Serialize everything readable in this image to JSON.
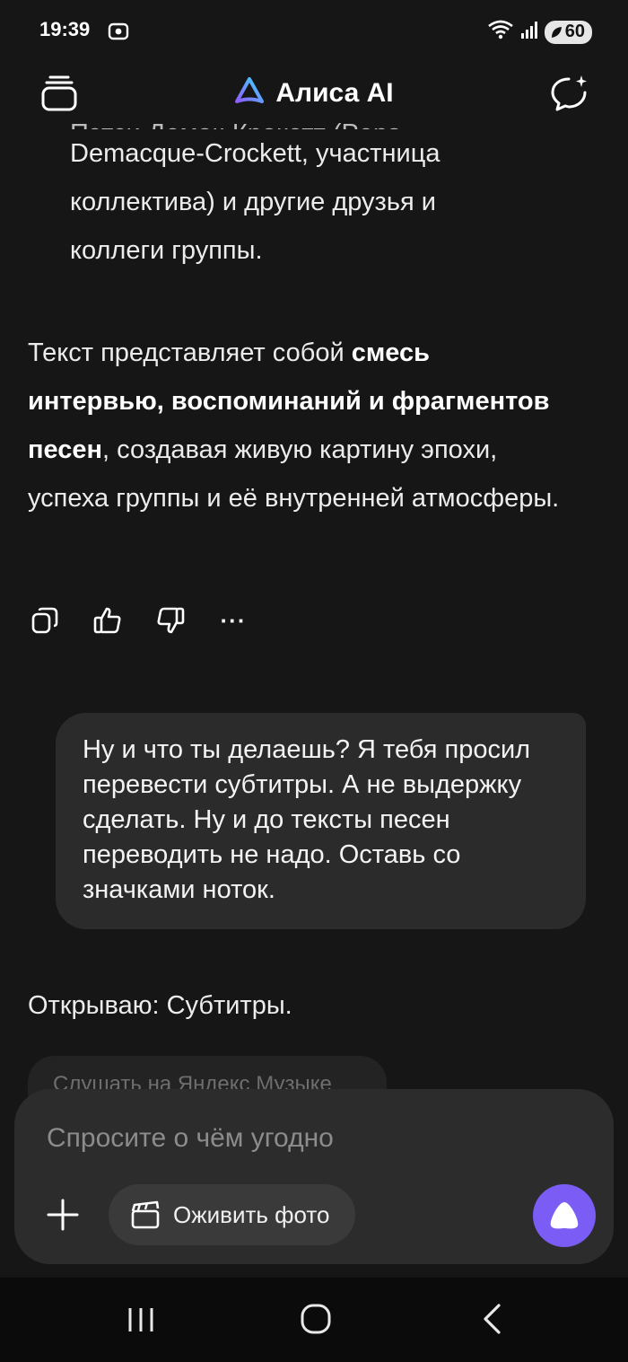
{
  "status_bar": {
    "time": "19:39",
    "battery": "60",
    "icons": [
      "screenshot-icon",
      "wifi-icon",
      "signal-icon",
      "battery-icon"
    ]
  },
  "header": {
    "title": "Алиса AI",
    "icons": [
      "chat-history-icon",
      "alisa-logo-icon",
      "new-chat-icon"
    ]
  },
  "assistant_message": {
    "list_cut_line": "Пэтси Демак-Крокетт (Peps",
    "list_lines": [
      "Demacque-Crockett, участница",
      "коллектива) и другие друзья и",
      "коллеги группы."
    ],
    "summary": {
      "part1": "Текст представляет собой ",
      "bold": "смесь интервью, воспоминаний и фрагментов песен",
      "part2": ", создавая живую картину эпохи, успеха группы и её внутренней атмосферы."
    },
    "actions": [
      "copy-icon",
      "thumbs-up-icon",
      "thumbs-down-icon",
      "more-icon"
    ],
    "more_label": "···"
  },
  "user_message": {
    "text": "Ну и что ты делаешь? Я тебя просил перевести субтитры. А не выдержку сделать. Ну и до тексты песен переводить не надо. Оставь со значками ноток."
  },
  "assistant_reply": {
    "text": "Открываю: Субтитры.",
    "chip_label": "Слушать на Яндекс Музыке"
  },
  "composer": {
    "placeholder": "Спросите о чём угодно",
    "revive_label": "Оживить фото",
    "accent_color": "#7b5cf5"
  },
  "nav_bar": {
    "icons": [
      "recent-apps-icon",
      "home-icon",
      "back-icon"
    ]
  }
}
